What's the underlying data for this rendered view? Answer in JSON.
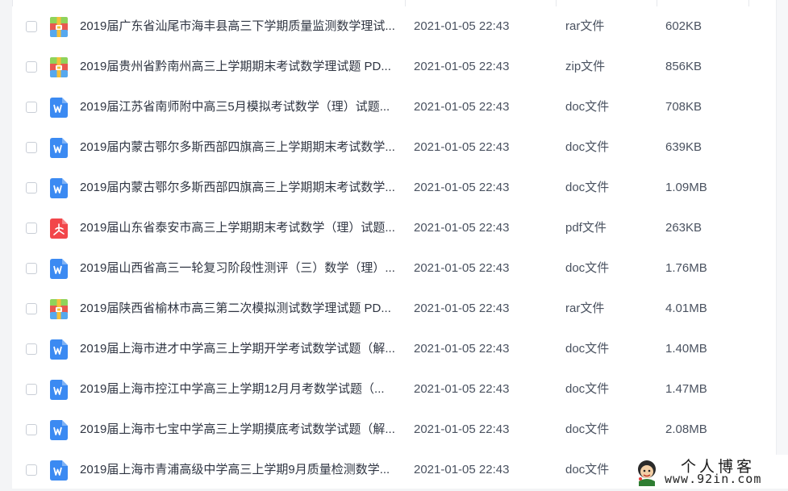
{
  "colors": {
    "doc_icon": "#3b8af2",
    "pdf_icon": "#f2464a",
    "archive_green": "#8fd35a",
    "archive_red": "#e8584f",
    "archive_blue": "#56a8ee",
    "archive_yellow": "#f5c03a"
  },
  "files": [
    {
      "name": "2019届广东省汕尾市海丰县高三下学期质量监测数学理试...",
      "date": "2021-01-05 22:43",
      "type": "rar文件",
      "size": "602KB",
      "icon": "archive-icon"
    },
    {
      "name": "2019届贵州省黔南州高三上学期期末考试数学理试题 PD...",
      "date": "2021-01-05 22:43",
      "type": "zip文件",
      "size": "856KB",
      "icon": "archive-icon"
    },
    {
      "name": "2019届江苏省南师附中高三5月模拟考试数学（理）试题...",
      "date": "2021-01-05 22:43",
      "type": "doc文件",
      "size": "708KB",
      "icon": "word-doc-icon"
    },
    {
      "name": "2019届内蒙古鄂尔多斯西部四旗高三上学期期末考试数学...",
      "date": "2021-01-05 22:43",
      "type": "doc文件",
      "size": "639KB",
      "icon": "word-doc-icon"
    },
    {
      "name": "2019届内蒙古鄂尔多斯西部四旗高三上学期期末考试数学...",
      "date": "2021-01-05 22:43",
      "type": "doc文件",
      "size": "1.09MB",
      "icon": "word-doc-icon"
    },
    {
      "name": "2019届山东省泰安市高三上学期期末考试数学（理）试题...",
      "date": "2021-01-05 22:43",
      "type": "pdf文件",
      "size": "263KB",
      "icon": "pdf-icon"
    },
    {
      "name": "2019届山西省高三一轮复习阶段性测评（三）数学（理）...",
      "date": "2021-01-05 22:43",
      "type": "doc文件",
      "size": "1.76MB",
      "icon": "word-doc-icon"
    },
    {
      "name": "2019届陕西省榆林市高三第二次模拟测试数学理试题 PD...",
      "date": "2021-01-05 22:43",
      "type": "rar文件",
      "size": "4.01MB",
      "icon": "archive-icon"
    },
    {
      "name": "2019届上海市进才中学高三上学期开学考试数学试题（解...",
      "date": "2021-01-05 22:43",
      "type": "doc文件",
      "size": "1.40MB",
      "icon": "word-doc-icon"
    },
    {
      "name": "2019届上海市控江中学高三上学期12月月考数学试题（...",
      "date": "2021-01-05 22:43",
      "type": "doc文件",
      "size": "1.47MB",
      "icon": "word-doc-icon"
    },
    {
      "name": "2019届上海市七宝中学高三上学期摸底考试数学试题（解...",
      "date": "2021-01-05 22:43",
      "type": "doc文件",
      "size": "2.08MB",
      "icon": "word-doc-icon"
    },
    {
      "name": "2019届上海市青浦高级中学高三上学期9月质量检测数学...",
      "date": "2021-01-05 22:43",
      "type": "doc文件",
      "size": "",
      "icon": "word-doc-icon"
    }
  ],
  "watermark": {
    "text_cn": "个人博客",
    "url": "www.92in.com"
  }
}
